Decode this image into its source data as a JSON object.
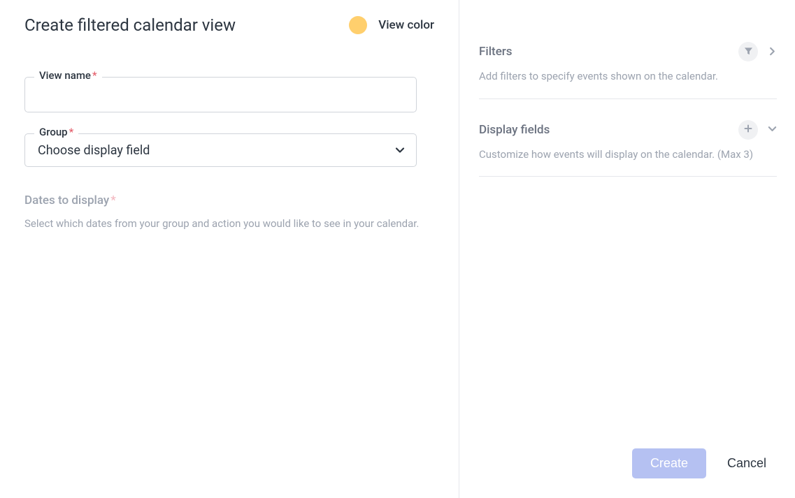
{
  "header": {
    "title": "Create filtered calendar view",
    "view_color_label": "View color",
    "view_color_value": "#ffcf6d"
  },
  "form": {
    "view_name": {
      "label": "View name",
      "required": true,
      "value": ""
    },
    "group": {
      "label": "Group",
      "required": true,
      "placeholder": "Choose display field",
      "value": ""
    },
    "dates_section": {
      "heading": "Dates to display",
      "required": true,
      "help_text": "Select which dates from your group and action you would like to see in your calendar."
    }
  },
  "right_panel": {
    "filters": {
      "title": "Filters",
      "description": "Add filters to specify events shown on the calendar."
    },
    "display_fields": {
      "title": "Display fields",
      "description": "Customize how events will display on the calendar. (Max 3)"
    }
  },
  "footer": {
    "create_label": "Create",
    "cancel_label": "Cancel"
  },
  "icons": {
    "filter": "filter-icon",
    "chevron_right": "chevron-right-icon",
    "chevron_down": "chevron-down-icon",
    "plus": "plus-icon"
  }
}
